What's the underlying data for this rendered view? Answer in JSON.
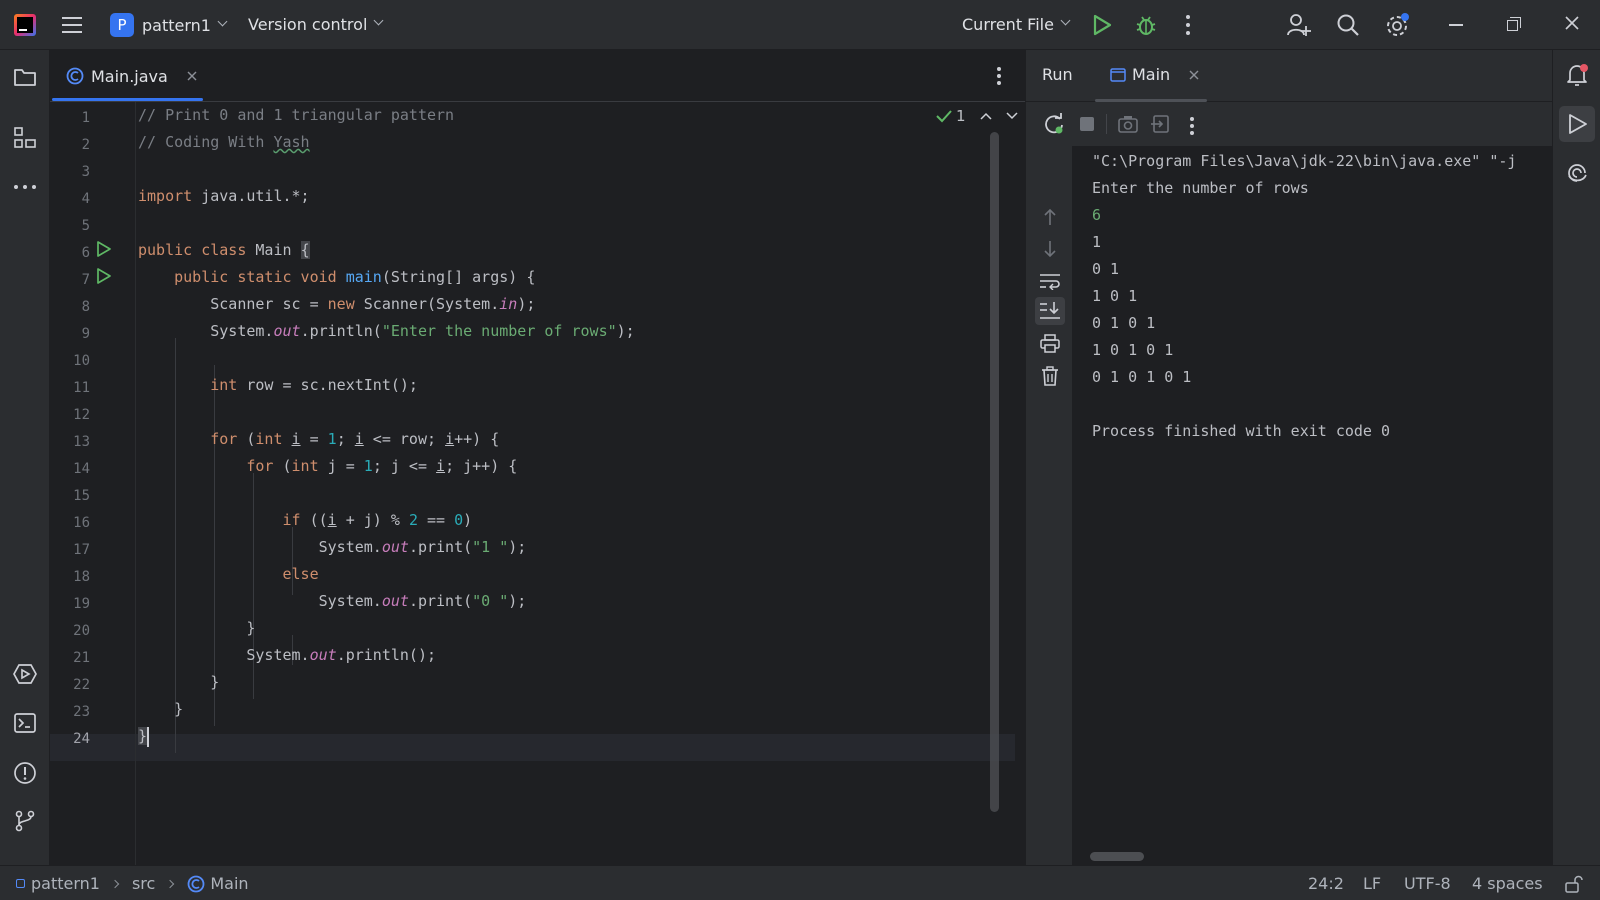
{
  "titlebar": {
    "project_letter": "P",
    "project_name": "pattern1",
    "vcs_label": "Version control",
    "run_config": "Current File"
  },
  "editor": {
    "tab_label": "Main.java",
    "inspection_count": "1",
    "line_numbers": [
      "1",
      "2",
      "3",
      "4",
      "5",
      "6",
      "7",
      "8",
      "9",
      "10",
      "11",
      "12",
      "13",
      "14",
      "15",
      "16",
      "17",
      "18",
      "19",
      "20",
      "21",
      "22",
      "23",
      "24"
    ]
  },
  "run_panel": {
    "title": "Run",
    "tab_label": "Main",
    "console_lines": [
      "\"C:\\Program Files\\Java\\jdk-22\\bin\\java.exe\" \"-j",
      "Enter the number of rows",
      "6",
      "1",
      "0 1",
      "1 0 1",
      "0 1 0 1",
      "1 0 1 0 1",
      "0 1 0 1 0 1",
      "",
      "Process finished with exit code 0"
    ]
  },
  "statusbar": {
    "breadcrumb_project": "pattern1",
    "breadcrumb_src": "src",
    "breadcrumb_class": "Main",
    "caret_position": "24:2",
    "line_separator": "LF",
    "encoding": "UTF-8",
    "indent": "4 spaces"
  },
  "colors": {
    "accent": "#3574f0",
    "run_green": "#5fb865",
    "keyword": "#cf8e6d",
    "string": "#6aab73",
    "number": "#2aacb8",
    "function": "#56a8f5",
    "comment": "#7a7e85"
  }
}
